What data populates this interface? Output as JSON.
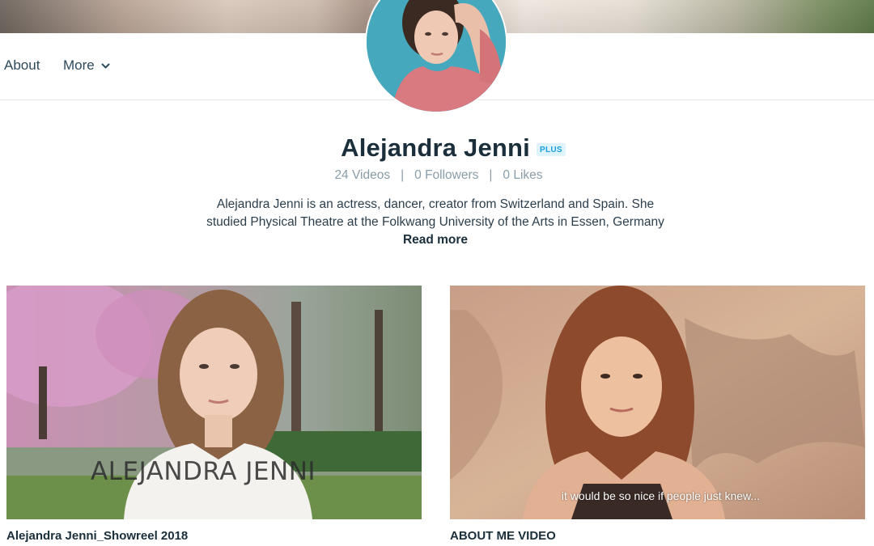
{
  "nav": {
    "about_label": "About",
    "more_label": "More"
  },
  "profile": {
    "name": "Alejandra Jenni",
    "badge": "PLUS",
    "stats": {
      "videos": "24 Videos",
      "followers": "0 Followers",
      "likes": "0 Likes"
    },
    "bio": "Alejandra Jenni is an actress, dancer, creator from Switzerland and Spain. She studied Physical Theatre at the Folkwang University of the Arts in Essen, Germany",
    "read_more": "Read more"
  },
  "videos": [
    {
      "title": "Alejandra Jenni_Showreel 2018",
      "overlay_text": "ALEJANDRA JENNI"
    },
    {
      "title": "ABOUT ME VIDEO",
      "subtitle_text": "it would be so nice if people just knew..."
    }
  ],
  "colors": {
    "text_primary": "#1a2e3b",
    "text_muted": "#8a9ca8",
    "badge_text": "#1aa0e0",
    "badge_bg": "#dff3fc",
    "avatar_bg": "#48a9bf"
  },
  "icons": {
    "more_dropdown": "chevron-down-icon"
  }
}
